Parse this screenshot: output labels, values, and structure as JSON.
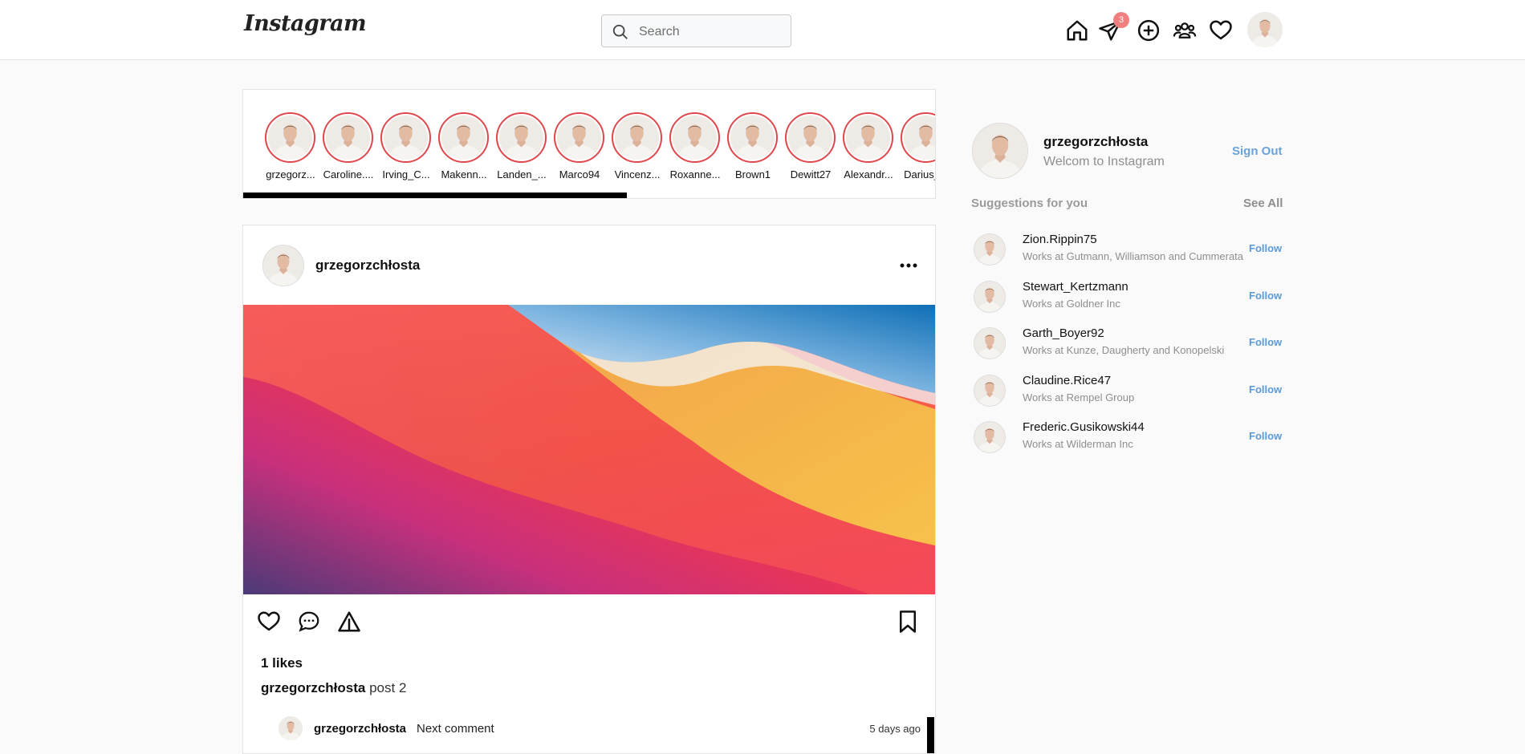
{
  "header": {
    "logo": "Instagram",
    "search_placeholder": "Search",
    "messages_badge": "3"
  },
  "stories": [
    {
      "name": "grzegorz..."
    },
    {
      "name": "Caroline...."
    },
    {
      "name": "Irving_C..."
    },
    {
      "name": "Makenn..."
    },
    {
      "name": "Landen_..."
    },
    {
      "name": "Marco94"
    },
    {
      "name": "Vincenz..."
    },
    {
      "name": "Roxanne..."
    },
    {
      "name": "Brown1"
    },
    {
      "name": "Dewitt27"
    },
    {
      "name": "Alexandr..."
    },
    {
      "name": "Darius_..."
    }
  ],
  "post": {
    "username": "grzegorzchłosta",
    "likes": "1 likes",
    "caption_user": "grzegorzchłosta",
    "caption_text": "post 2",
    "comment": {
      "user": "grzegorzchłosta",
      "text": "Next comment",
      "time": "5 days ago"
    }
  },
  "sidebar": {
    "username": "grzegorzchłosta",
    "subtitle": "Welcom to Instagram",
    "sign_out": "Sign Out",
    "suggestions_title": "Suggestions for you",
    "see_all": "See All",
    "suggestions": [
      {
        "name": "Zion.Rippin75",
        "work": "Works at Gutmann, Williamson and Cummerata",
        "action": "Follow"
      },
      {
        "name": "Stewart_Kertzmann",
        "work": "Works at Goldner Inc",
        "action": "Follow"
      },
      {
        "name": "Garth_Boyer92",
        "work": "Works at Kunze, Daugherty and Konopelski",
        "action": "Follow"
      },
      {
        "name": "Claudine.Rice47",
        "work": "Works at Rempel Group",
        "action": "Follow"
      },
      {
        "name": "Frederic.Gusikowski44",
        "work": "Works at Wilderman Inc",
        "action": "Follow"
      }
    ]
  }
}
